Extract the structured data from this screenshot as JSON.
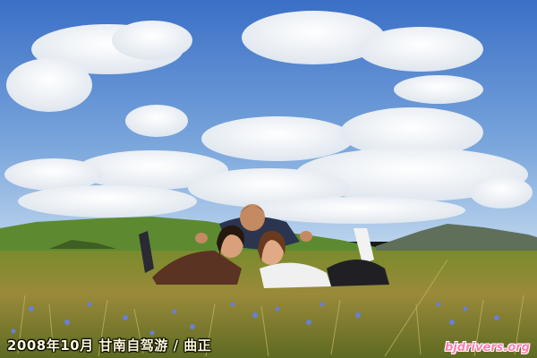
{
  "caption": "2008年10月 甘南自驾游 / 曲正",
  "watermark": "bjdrivers.org",
  "colors": {
    "sky_top": "#3d72c9",
    "sky_bottom": "#9cc0e6",
    "cloud": "#f4f6f8",
    "hill_green": "#5c8a2e",
    "mountain_far": "#6b7d64",
    "grass": "#8a8a2e",
    "flower_blue": "#6a7fd6"
  }
}
